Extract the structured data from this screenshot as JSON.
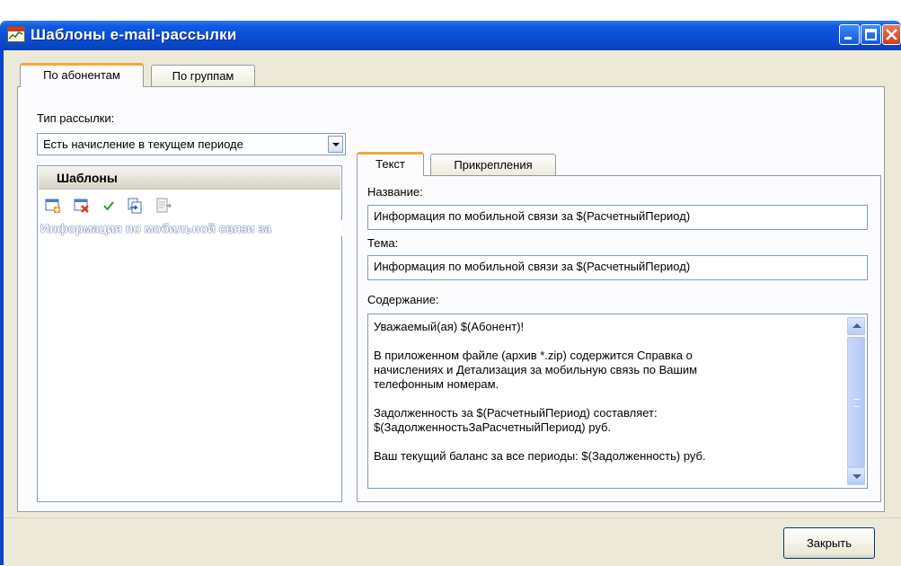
{
  "window": {
    "title": "Шаблоны e-mail-рассылки"
  },
  "outer_tabs": [
    {
      "label": "По абонентам",
      "active": true
    },
    {
      "label": "По группам",
      "active": false
    }
  ],
  "left": {
    "mailing_type_label": "Тип рассылки:",
    "mailing_type_value": "Есть начисление в текущем периоде",
    "templates_header": "Шаблоны",
    "toolbar_icons": [
      "add-template-icon",
      "delete-template-icon",
      "check-icon",
      "copy-template-icon",
      "import-template-icon"
    ],
    "templates": [
      {
        "label": "Информация по мобильной связи за",
        "selected": true
      }
    ]
  },
  "right": {
    "tabs": [
      {
        "label": "Текст",
        "active": true
      },
      {
        "label": "Прикрепления",
        "active": false
      }
    ],
    "name_label": "Название:",
    "name_value": "Информация по мобильной связи за $(РасчетныйПериод)",
    "subject_label": "Тема:",
    "subject_value": "Информация по мобильной связи за $(РасчетныйПериод)",
    "content_label": "Содержание:",
    "content_value": "Уважаемый(ая) $(Абонент)!\n\nВ приложенном файле (архив *.zip) содержится Справка о\nначислениях и Детализация за мобильную связь по Вашим\nтелефонным номерам.\n\nЗадолженность за $(РасчетныйПериод) составляет:\n$(ЗадолженностьЗаРасчетныйПериод) руб.\n\nВаш текущий баланс за все периоды: $(Задолженность) руб."
  },
  "buttons": {
    "close_label": "Закрыть"
  }
}
